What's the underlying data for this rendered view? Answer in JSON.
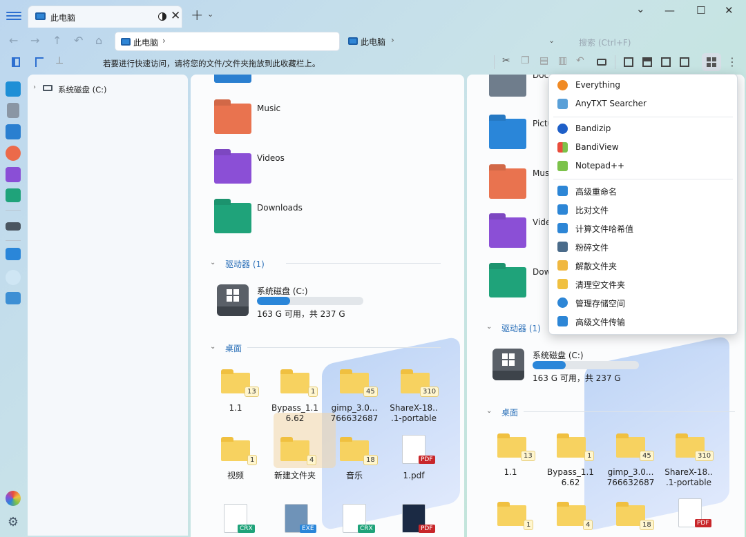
{
  "window": {
    "tab_title": "此电脑",
    "new_tab": "+",
    "tab_dropdown": "⌄",
    "min": "—",
    "max": "☐",
    "close": "✕",
    "collapse": "⌄"
  },
  "nav": {
    "back": "←",
    "forward": "→",
    "up": "↑",
    "undo": "↶",
    "home": "⌂"
  },
  "address": {
    "left": "此电脑",
    "right": "此电脑",
    "chevron": "›",
    "dropdown": "⌄"
  },
  "search": {
    "placeholder": "搜索 (Ctrl+F)"
  },
  "toolbar": {
    "hint": "若要进行快速访问，请将您的文件/文件夹拖放到此收藏栏上。",
    "more": "⋮"
  },
  "tree": {
    "expand": "›",
    "drive": "系统磁盘 (C:)"
  },
  "pane1": {
    "folders": [
      {
        "label": "Music",
        "color": "#e9734f"
      },
      {
        "label": "Videos",
        "color": "#8b4fd6"
      },
      {
        "label": "Downloads",
        "color": "#1fa37a"
      }
    ],
    "drives_header": "驱动器 (1)",
    "drive": {
      "name": "系统磁盘 (C:)",
      "free": "163 G 可用，共 237 G",
      "used_fraction": 0.31
    },
    "desktop_header": "桌面",
    "row1": [
      {
        "name": "1.1",
        "badge": "13"
      },
      {
        "name": "Bypass_1.1\n6.62",
        "badge": "1"
      },
      {
        "name": "gimp_3.0...\n766632687",
        "badge": "45"
      },
      {
        "name": "ShareX-18..\n.1-portable",
        "badge": "310"
      }
    ],
    "row2": [
      {
        "name": "视频",
        "badge": "1"
      },
      {
        "name": "新建文件夹",
        "badge": "4"
      },
      {
        "name": "音乐",
        "badge": "18"
      },
      {
        "name": "1.pdf",
        "tag": "PDF"
      }
    ],
    "row3": [
      {
        "tag": "CRX"
      },
      {
        "tag": "EXE"
      },
      {
        "tag": "CRX"
      },
      {
        "tag": "PDF"
      }
    ]
  },
  "pane2": {
    "folders": [
      {
        "label": "Doc"
      },
      {
        "label": "Pictu"
      },
      {
        "label": "Mus"
      },
      {
        "label": "Vide"
      },
      {
        "label": "Dow"
      }
    ],
    "drives_header": "驱动器 (1)",
    "drive": {
      "name": "系统磁盘 (C:)",
      "free": "163 G 可用，共 237 G",
      "used_fraction": 0.31
    },
    "desktop_header": "桌面",
    "row1": [
      {
        "name": "1.1",
        "badge": "13"
      },
      {
        "name": "Bypass_1.1\n6.62",
        "badge": "1"
      },
      {
        "name": "gimp_3.0...\n766632687",
        "badge": "45"
      },
      {
        "name": "ShareX-18..\n.1-portable",
        "badge": "310"
      }
    ],
    "row2": [
      {
        "badge": "1"
      },
      {
        "badge": "4"
      },
      {
        "badge": "18"
      },
      {
        "tag": "PDF"
      }
    ]
  },
  "menu": {
    "items": [
      {
        "label": "Everything",
        "color": "#f08a24"
      },
      {
        "label": "AnyTXT Searcher",
        "color": "#5aa0d8"
      },
      {
        "label": "Bandizip",
        "color": "#1e5fc8"
      },
      {
        "label": "BandiView",
        "color": "#e94d3c"
      },
      {
        "label": "Notepad++",
        "color": "#7cc24a"
      },
      {
        "label": "高级重命名",
        "color": "#2d86d6"
      },
      {
        "label": "比对文件",
        "color": "#2d86d6"
      },
      {
        "label": "计算文件哈希值",
        "color": "#2d86d6"
      },
      {
        "label": "粉碎文件",
        "color": "#4a6b8a"
      },
      {
        "label": "解散文件夹",
        "color": "#f0b840"
      },
      {
        "label": "清理空文件夹",
        "color": "#f0c040"
      },
      {
        "label": "管理存储空间",
        "color": "#2d86d6"
      },
      {
        "label": "高级文件传输",
        "color": "#2d86d6"
      }
    ]
  }
}
